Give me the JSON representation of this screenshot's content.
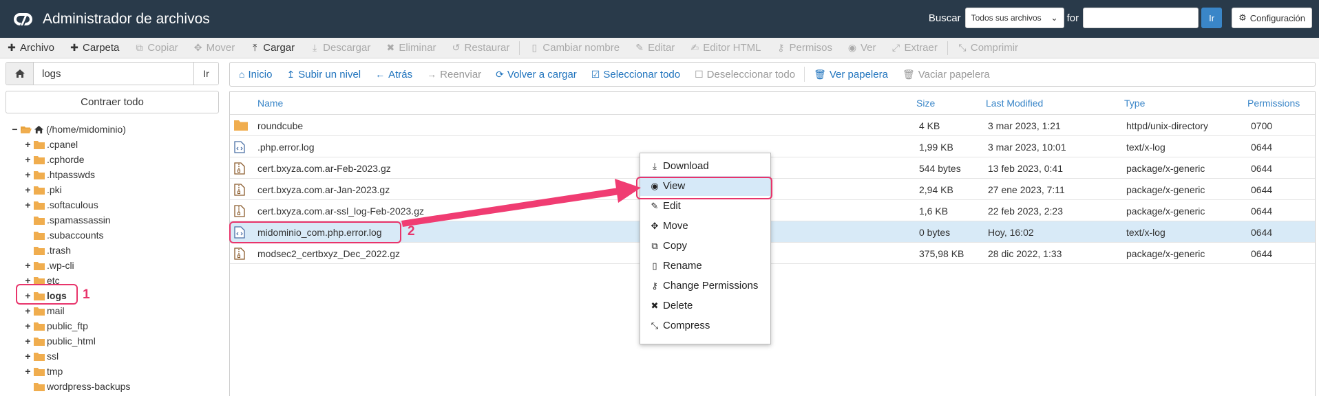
{
  "header": {
    "title": "Administrador de archivos",
    "search_label": "Buscar",
    "search_scope": "Todos sus archivos",
    "for_label": "for",
    "go_label": "Ir",
    "config_label": "Configuración"
  },
  "toolbar": [
    {
      "label": "Archivo",
      "icon": "plus-icon",
      "enabled": true
    },
    {
      "label": "Carpeta",
      "icon": "plus-icon",
      "enabled": true
    },
    {
      "label": "Copiar",
      "icon": "copy-icon",
      "enabled": false
    },
    {
      "label": "Mover",
      "icon": "move-icon",
      "enabled": false
    },
    {
      "label": "Cargar",
      "icon": "upload-icon",
      "enabled": true
    },
    {
      "label": "Descargar",
      "icon": "download-icon",
      "enabled": false
    },
    {
      "label": "Eliminar",
      "icon": "times-icon",
      "enabled": false
    },
    {
      "label": "Restaurar",
      "icon": "undo-icon",
      "enabled": false
    },
    {
      "label": "Cambiar nombre",
      "icon": "file-icon",
      "enabled": false
    },
    {
      "label": "Editar",
      "icon": "pencil-icon",
      "enabled": false
    },
    {
      "label": "Editor HTML",
      "icon": "edit-icon",
      "enabled": false
    },
    {
      "label": "Permisos",
      "icon": "key-icon",
      "enabled": false
    },
    {
      "label": "Ver",
      "icon": "eye-icon",
      "enabled": false
    },
    {
      "label": "Extraer",
      "icon": "expand-icon",
      "enabled": false
    },
    {
      "label": "Comprimir",
      "icon": "compress-icon",
      "enabled": false
    }
  ],
  "left": {
    "path_value": "logs",
    "path_go": "Ir",
    "collapse_label": "Contraer todo",
    "tree_root": "(/home/midominio)",
    "tree": [
      {
        "name": ".cpanel",
        "expandable": true
      },
      {
        "name": ".cphorde",
        "expandable": true
      },
      {
        "name": ".htpasswds",
        "expandable": true
      },
      {
        "name": ".pki",
        "expandable": true
      },
      {
        "name": ".softaculous",
        "expandable": true
      },
      {
        "name": ".spamassassin",
        "expandable": false
      },
      {
        "name": ".subaccounts",
        "expandable": false
      },
      {
        "name": ".trash",
        "expandable": false
      },
      {
        "name": ".wp-cli",
        "expandable": true
      },
      {
        "name": "etc",
        "expandable": true
      },
      {
        "name": "logs",
        "expandable": true,
        "bold": true
      },
      {
        "name": "mail",
        "expandable": true
      },
      {
        "name": "public_ftp",
        "expandable": true
      },
      {
        "name": "public_html",
        "expandable": true
      },
      {
        "name": "ssl",
        "expandable": true
      },
      {
        "name": "tmp",
        "expandable": true
      },
      {
        "name": "wordpress-backups",
        "expandable": false
      }
    ]
  },
  "nav": [
    {
      "label": "Inicio",
      "icon": "home-icon",
      "enabled": true
    },
    {
      "label": "Subir un nivel",
      "icon": "level-up-icon",
      "enabled": true
    },
    {
      "label": "Atrás",
      "icon": "arrow-left-icon",
      "enabled": true
    },
    {
      "label": "Reenviar",
      "icon": "arrow-right-icon",
      "enabled": false
    },
    {
      "label": "Volver a cargar",
      "icon": "refresh-icon",
      "enabled": true
    },
    {
      "label": "Seleccionar todo",
      "icon": "checkbox-checked-icon",
      "enabled": true
    },
    {
      "label": "Deseleccionar todo",
      "icon": "checkbox-icon",
      "enabled": false
    },
    {
      "label": "Ver papelera",
      "icon": "trash-icon",
      "enabled": true
    },
    {
      "label": "Vaciar papelera",
      "icon": "trash-icon",
      "enabled": false
    }
  ],
  "columns": {
    "name": "Name",
    "size": "Size",
    "modified": "Last Modified",
    "type": "Type",
    "perms": "Permissions"
  },
  "files": [
    {
      "icon": "folder",
      "name": "roundcube",
      "size": "4 KB",
      "modified": "3 mar 2023, 1:21",
      "type": "httpd/unix-directory",
      "perms": "0700"
    },
    {
      "icon": "code",
      "name": ".php.error.log",
      "size": "1,99 KB",
      "modified": "3 mar 2023, 10:01",
      "type": "text/x-log",
      "perms": "0644"
    },
    {
      "icon": "zip",
      "name": "cert.bxyza.com.ar-Feb-2023.gz",
      "size": "544 bytes",
      "modified": "13 feb 2023, 0:41",
      "type": "package/x-generic",
      "perms": "0644"
    },
    {
      "icon": "zip",
      "name": "cert.bxyza.com.ar-Jan-2023.gz",
      "size": "2,94 KB",
      "modified": "27 ene 2023, 7:11",
      "type": "package/x-generic",
      "perms": "0644"
    },
    {
      "icon": "zip",
      "name": "cert.bxyza.com.ar-ssl_log-Feb-2023.gz",
      "size": "1,6 KB",
      "modified": "22 feb 2023, 2:23",
      "type": "package/x-generic",
      "perms": "0644"
    },
    {
      "icon": "code",
      "name": "midominio_com.php.error.log",
      "size": "0 bytes",
      "modified": "Hoy, 16:02",
      "type": "text/x-log",
      "perms": "0644",
      "selected": true
    },
    {
      "icon": "zip",
      "name": "modsec2_certbxyz_Dec_2022.gz",
      "size": "375,98 KB",
      "modified": "28 dic 2022, 1:33",
      "type": "package/x-generic",
      "perms": "0644"
    }
  ],
  "context_menu": [
    {
      "label": "Download",
      "icon": "download-icon"
    },
    {
      "label": "View",
      "icon": "eye-icon",
      "highlighted": true
    },
    {
      "label": "Edit",
      "icon": "pencil-icon"
    },
    {
      "label": "Move",
      "icon": "move-icon"
    },
    {
      "label": "Copy",
      "icon": "copy-icon"
    },
    {
      "label": "Rename",
      "icon": "file-icon"
    },
    {
      "label": "Change Permissions",
      "icon": "key-icon"
    },
    {
      "label": "Delete",
      "icon": "times-icon"
    },
    {
      "label": "Compress",
      "icon": "compress-icon"
    }
  ],
  "annotations": {
    "step1": "1",
    "step2": "2",
    "color": "#e8346b"
  },
  "colors": {
    "header_bg": "#293a4a",
    "link": "#1f73bd",
    "accent": "#3a86c8",
    "selected_row": "#d8eaf7",
    "folder": "#f0ad4e"
  }
}
